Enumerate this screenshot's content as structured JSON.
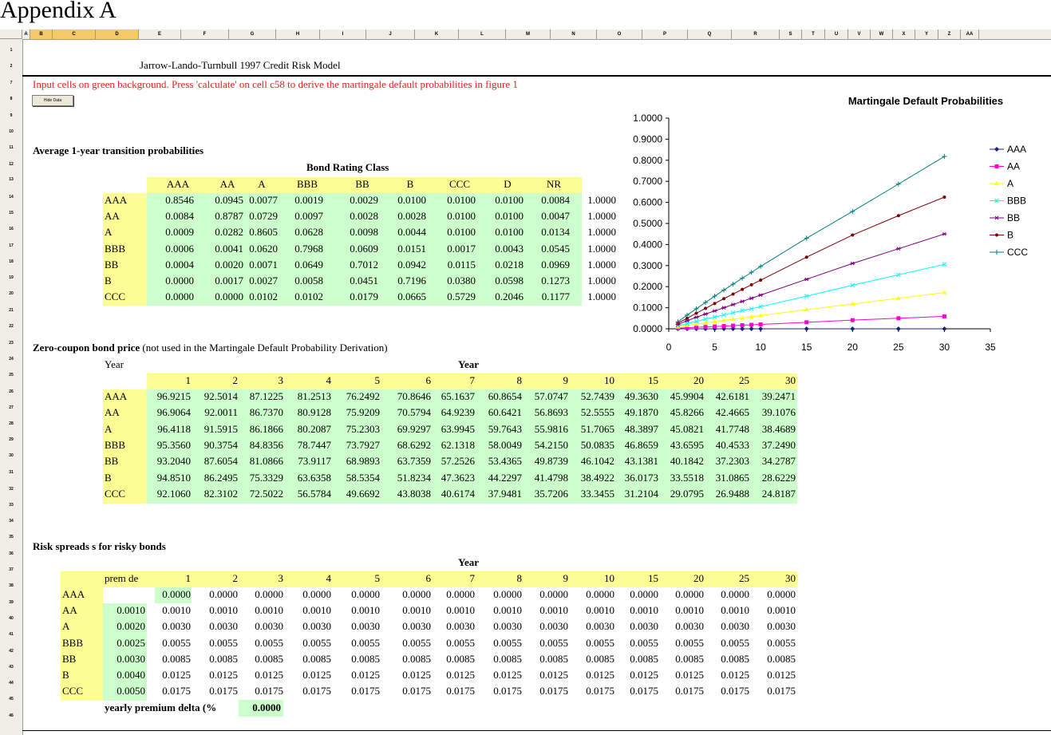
{
  "heading": "Appendix A",
  "sheet": {
    "columns": [
      "A",
      "B",
      "C",
      "D",
      "E",
      "F",
      "G",
      "H",
      "I",
      "J",
      "K",
      "L",
      "M",
      "N",
      "O",
      "P",
      "Q",
      "R",
      "S",
      "T",
      "U",
      "V",
      "W",
      "X",
      "Y",
      "Z",
      "AA"
    ],
    "rows": [
      "1",
      "2",
      "7",
      "8",
      "9",
      "10",
      "11",
      "12",
      "13",
      "14",
      "15",
      "16",
      "17",
      "18",
      "19",
      "20",
      "21",
      "22",
      "23",
      "24",
      "25",
      "26",
      "27",
      "28",
      "29",
      "30",
      "31",
      "32",
      "33",
      "34",
      "35",
      "36",
      "37",
      "38",
      "39",
      "40",
      "41",
      "42",
      "43",
      "44",
      "45",
      "46"
    ]
  },
  "model_title": "Jarrow-Lando-Turnbull 1997 Credit Risk Model",
  "instructions": "Input cells on green background. Press 'calculate' on cell c58 to derive the martingale default probabilities in figure 1",
  "hide_button": "Hide Data",
  "transition": {
    "title": "Average 1-year transition probabilities",
    "subtitle": "Bond Rating Class",
    "columns": [
      "AAA",
      "AA",
      "A",
      "BBB",
      "BB",
      "B",
      "CCC",
      "D",
      "NR"
    ],
    "rows": [
      {
        "label": "AAA",
        "values": [
          "0.8546",
          "0.0945",
          "0.0077",
          "0.0019",
          "0.0029",
          "0.0100",
          "0.0100",
          "0.0100",
          "0.0084"
        ],
        "total": "1.0000"
      },
      {
        "label": "AA",
        "values": [
          "0.0084",
          "0.8787",
          "0.0729",
          "0.0097",
          "0.0028",
          "0.0028",
          "0.0100",
          "0.0100",
          "0.0047"
        ],
        "total": "1.0000"
      },
      {
        "label": "A",
        "values": [
          "0.0009",
          "0.0282",
          "0.8605",
          "0.0628",
          "0.0098",
          "0.0044",
          "0.0100",
          "0.0100",
          "0.0134"
        ],
        "total": "1.0000"
      },
      {
        "label": "BBB",
        "values": [
          "0.0006",
          "0.0041",
          "0.0620",
          "0.7968",
          "0.0609",
          "0.0151",
          "0.0017",
          "0.0043",
          "0.0545"
        ],
        "total": "1.0000"
      },
      {
        "label": "BB",
        "values": [
          "0.0004",
          "0.0020",
          "0.0071",
          "0.0649",
          "0.7012",
          "0.0942",
          "0.0115",
          "0.0218",
          "0.0969"
        ],
        "total": "1.0000"
      },
      {
        "label": "B",
        "values": [
          "0.0000",
          "0.0017",
          "0.0027",
          "0.0058",
          "0.0451",
          "0.7196",
          "0.0380",
          "0.0598",
          "0.1273"
        ],
        "total": "1.0000"
      },
      {
        "label": "CCC",
        "values": [
          "0.0000",
          "0.0000",
          "0.0102",
          "0.0102",
          "0.0179",
          "0.0665",
          "0.5729",
          "0.2046",
          "0.1177"
        ],
        "total": "1.0000"
      }
    ]
  },
  "zcb": {
    "title_bold": "Zero-coupon bond price",
    "title_rest": " (not used in the Martingale Default Probability Derivation)",
    "year_label": "Year",
    "year_header": "Year",
    "years": [
      "1",
      "2",
      "3",
      "4",
      "5",
      "6",
      "7",
      "8",
      "9",
      "10",
      "15",
      "20",
      "25",
      "30"
    ],
    "rows": [
      {
        "label": "AAA",
        "values": [
          "96.9215",
          "92.5014",
          "87.1225",
          "81.2513",
          "76.2492",
          "70.8646",
          "65.1637",
          "60.8654",
          "57.0747",
          "52.7439",
          "49.3630",
          "45.9904",
          "42.6181",
          "39.2471"
        ]
      },
      {
        "label": "AA",
        "values": [
          "96.9064",
          "92.0011",
          "86.7370",
          "80.9128",
          "75.9209",
          "70.5794",
          "64.9239",
          "60.6421",
          "56.8693",
          "52.5555",
          "49.1870",
          "45.8266",
          "42.4665",
          "39.1076"
        ]
      },
      {
        "label": "A",
        "values": [
          "96.4118",
          "91.5915",
          "86.1866",
          "80.2087",
          "75.2303",
          "69.9297",
          "63.9945",
          "59.7643",
          "55.9816",
          "51.7065",
          "48.3897",
          "45.0821",
          "41.7748",
          "38.4689"
        ]
      },
      {
        "label": "BBB",
        "values": [
          "95.3560",
          "90.3754",
          "84.8356",
          "78.7447",
          "73.7927",
          "68.6292",
          "62.1318",
          "58.0049",
          "54.2150",
          "50.0835",
          "46.8659",
          "43.6595",
          "40.4533",
          "37.2490"
        ]
      },
      {
        "label": "BB",
        "values": [
          "93.2040",
          "87.6054",
          "81.0866",
          "73.9117",
          "68.9893",
          "63.7359",
          "57.2526",
          "53.4365",
          "49.8739",
          "46.1042",
          "43.1381",
          "40.1842",
          "37.2303",
          "34.2787"
        ]
      },
      {
        "label": "B",
        "values": [
          "94.8510",
          "86.2495",
          "75.3329",
          "63.6358",
          "58.5354",
          "51.8234",
          "47.3623",
          "44.2297",
          "41.4798",
          "38.4922",
          "36.0173",
          "33.5518",
          "31.0865",
          "28.6229"
        ]
      },
      {
        "label": "CCC",
        "values": [
          "92.1060",
          "82.3102",
          "72.5022",
          "56.5784",
          "49.6692",
          "43.8038",
          "40.6174",
          "37.9481",
          "35.7206",
          "33.3455",
          "31.2104",
          "29.0795",
          "26.9488",
          "24.8187"
        ]
      }
    ]
  },
  "spreads": {
    "title": "Risk spreads  s  for risky bonds",
    "year_header": "Year",
    "prem_label": "prem de",
    "years": [
      "1",
      "2",
      "3",
      "4",
      "5",
      "6",
      "7",
      "8",
      "9",
      "10",
      "15",
      "20",
      "25",
      "30"
    ],
    "rows": [
      {
        "label": "AAA",
        "prem": "",
        "values": [
          "0.0000",
          "0.0000",
          "0.0000",
          "0.0000",
          "0.0000",
          "0.0000",
          "0.0000",
          "0.0000",
          "0.0000",
          "0.0000",
          "0.0000",
          "0.0000",
          "0.0000",
          "0.0000"
        ]
      },
      {
        "label": "AA",
        "prem": "0.0010",
        "values": [
          "0.0010",
          "0.0010",
          "0.0010",
          "0.0010",
          "0.0010",
          "0.0010",
          "0.0010",
          "0.0010",
          "0.0010",
          "0.0010",
          "0.0010",
          "0.0010",
          "0.0010",
          "0.0010"
        ]
      },
      {
        "label": "A",
        "prem": "0.0020",
        "values": [
          "0.0030",
          "0.0030",
          "0.0030",
          "0.0030",
          "0.0030",
          "0.0030",
          "0.0030",
          "0.0030",
          "0.0030",
          "0.0030",
          "0.0030",
          "0.0030",
          "0.0030",
          "0.0030"
        ]
      },
      {
        "label": "BBB",
        "prem": "0.0025",
        "values": [
          "0.0055",
          "0.0055",
          "0.0055",
          "0.0055",
          "0.0055",
          "0.0055",
          "0.0055",
          "0.0055",
          "0.0055",
          "0.0055",
          "0.0055",
          "0.0055",
          "0.0055",
          "0.0055"
        ]
      },
      {
        "label": "BB",
        "prem": "0.0030",
        "values": [
          "0.0085",
          "0.0085",
          "0.0085",
          "0.0085",
          "0.0085",
          "0.0085",
          "0.0085",
          "0.0085",
          "0.0085",
          "0.0085",
          "0.0085",
          "0.0085",
          "0.0085",
          "0.0085"
        ]
      },
      {
        "label": "B",
        "prem": "0.0040",
        "values": [
          "0.0125",
          "0.0125",
          "0.0125",
          "0.0125",
          "0.0125",
          "0.0125",
          "0.0125",
          "0.0125",
          "0.0125",
          "0.0125",
          "0.0125",
          "0.0125",
          "0.0125",
          "0.0125"
        ]
      },
      {
        "label": "CCC",
        "prem": "0.0050",
        "values": [
          "0.0175",
          "0.0175",
          "0.0175",
          "0.0175",
          "0.0175",
          "0.0175",
          "0.0175",
          "0.0175",
          "0.0175",
          "0.0175",
          "0.0175",
          "0.0175",
          "0.0175",
          "0.0175"
        ]
      }
    ],
    "delta_label": "yearly premium delta (%",
    "delta_value": "0.0000"
  },
  "chart_data": {
    "type": "line",
    "title": "Martingale Default Probabilities",
    "xlim": [
      0,
      35
    ],
    "ylim": [
      0,
      1
    ],
    "xticks": [
      "0",
      "5",
      "10",
      "15",
      "20",
      "25",
      "30",
      "35"
    ],
    "yticks": [
      "0.0000",
      "0.1000",
      "0.2000",
      "0.3000",
      "0.4000",
      "0.5000",
      "0.6000",
      "0.7000",
      "0.8000",
      "0.9000",
      "1.0000"
    ],
    "x": [
      1,
      2,
      3,
      4,
      5,
      6,
      7,
      8,
      9,
      10,
      15,
      20,
      25,
      30
    ],
    "legend_position": "right",
    "series": [
      {
        "name": "AAA",
        "color": "#1a237e",
        "marker": "diamond",
        "values": [
          0,
          0,
          0,
          0,
          0,
          0,
          0,
          0,
          0,
          0,
          0,
          0,
          0,
          0
        ]
      },
      {
        "name": "AA",
        "color": "#ff00cc",
        "marker": "square",
        "values": [
          0.003,
          0.005,
          0.007,
          0.009,
          0.011,
          0.013,
          0.015,
          0.017,
          0.019,
          0.021,
          0.031,
          0.041,
          0.05,
          0.059
        ]
      },
      {
        "name": "A",
        "color": "#ffff00",
        "marker": "triangle",
        "values": [
          0.009,
          0.016,
          0.022,
          0.028,
          0.034,
          0.04,
          0.046,
          0.051,
          0.057,
          0.063,
          0.091,
          0.118,
          0.145,
          0.172
        ]
      },
      {
        "name": "BBB",
        "color": "#00ffff",
        "marker": "x",
        "values": [
          0.014,
          0.025,
          0.035,
          0.046,
          0.056,
          0.066,
          0.076,
          0.086,
          0.095,
          0.105,
          0.155,
          0.207,
          0.256,
          0.306
        ]
      },
      {
        "name": "BB",
        "color": "#800080",
        "marker": "star",
        "values": [
          0.021,
          0.038,
          0.055,
          0.07,
          0.085,
          0.1,
          0.115,
          0.13,
          0.145,
          0.16,
          0.235,
          0.31,
          0.38,
          0.45
        ]
      },
      {
        "name": "B",
        "color": "#800000",
        "marker": "dot",
        "values": [
          0.027,
          0.05,
          0.074,
          0.097,
          0.12,
          0.143,
          0.165,
          0.187,
          0.209,
          0.231,
          0.34,
          0.445,
          0.537,
          0.625
        ]
      },
      {
        "name": "CCC",
        "color": "#008080",
        "marker": "plus",
        "values": [
          0.033,
          0.065,
          0.095,
          0.125,
          0.155,
          0.184,
          0.212,
          0.24,
          0.268,
          0.296,
          0.43,
          0.557,
          0.687,
          0.818
        ]
      }
    ]
  }
}
